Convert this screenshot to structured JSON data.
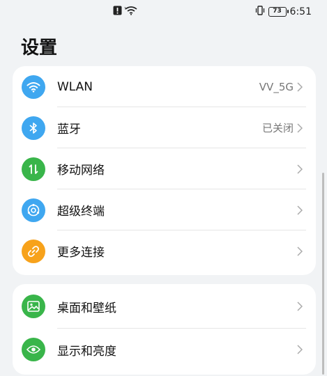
{
  "status_bar": {
    "battery": "73",
    "time": "6:51",
    "icons": [
      "alert-icon",
      "wifi-small-icon",
      "vibrate-icon"
    ]
  },
  "page": {
    "title": "设置"
  },
  "groups": [
    {
      "items": [
        {
          "label": "WLAN",
          "value": "VV_5G",
          "icon": "wifi-icon",
          "color": "#3fa7f0"
        },
        {
          "label": "蓝牙",
          "value": "已关闭",
          "icon": "bluetooth-icon",
          "color": "#3fa7f0"
        },
        {
          "label": "移动网络",
          "value": "",
          "icon": "mobile-data-icon",
          "color": "#39b54a"
        },
        {
          "label": "超级终端",
          "value": "",
          "icon": "super-device-icon",
          "color": "#3fa7f0"
        },
        {
          "label": "更多连接",
          "value": "",
          "icon": "link-icon",
          "color": "#f7a21b"
        }
      ]
    },
    {
      "items": [
        {
          "label": "桌面和壁纸",
          "value": "",
          "icon": "wallpaper-icon",
          "color": "#39b54a"
        },
        {
          "label": "显示和亮度",
          "value": "",
          "icon": "eye-icon",
          "color": "#39b54a"
        }
      ]
    }
  ]
}
